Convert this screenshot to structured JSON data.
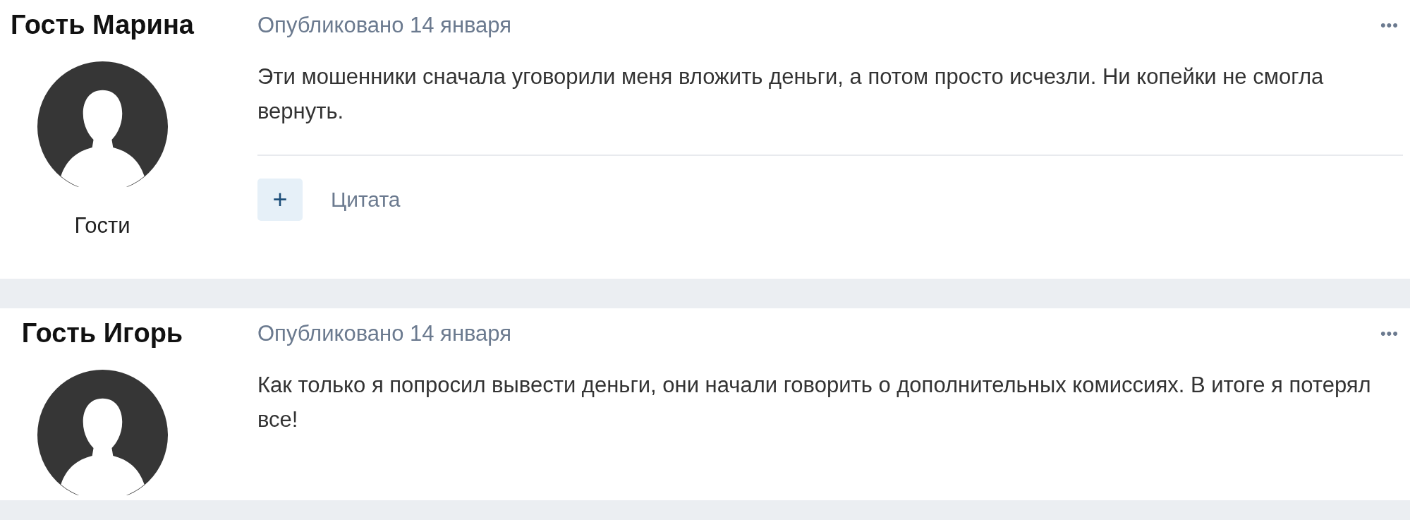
{
  "posts": [
    {
      "author": "Гость Марина",
      "role": "Гости",
      "date": "Опубликовано 14 января",
      "body": "Эти мошенники сначала уговорили меня вложить деньги, а потом просто исчезли. Ни копейки не смогла вернуть.",
      "menu": "•••",
      "actions": {
        "plus": "+",
        "quote": "Цитата"
      }
    },
    {
      "author": "Гость Игорь",
      "date": "Опубликовано 14 января",
      "body": "Как только я попросил вывести деньги, они начали говорить о дополнительных комиссиях. В итоге я потерял все!",
      "menu": "•••"
    }
  ]
}
